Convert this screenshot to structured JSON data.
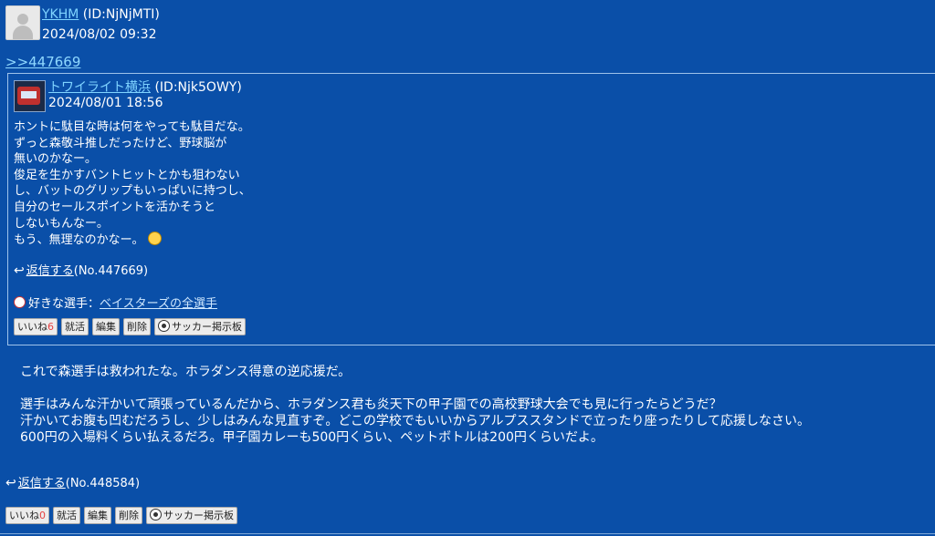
{
  "post": {
    "username": "YKHM",
    "user_id": "(ID:NjNjMTI)",
    "date": "2024/08/02 09:32",
    "reply_anchor": ">>447669",
    "quote": {
      "username": "トワイライト横浜",
      "user_id": "(ID:Njk5OWY)",
      "date": "2024/08/01 18:56",
      "body_lines": [
        "ホントに駄目な時は何をやっても駄目だな。",
        "ずっと森敬斗推しだったけど、野球脳が",
        "無いのかなー。",
        "俊足を生かすバントヒットとかも狙わない",
        "し、バットのグリップもいっぱいに持つし、",
        "自分のセールスポイントを活かそうと",
        "しないもんなー。",
        "もう、無理なのかなー。"
      ],
      "reply_label": "返信する",
      "reply_no": "(No.447669)",
      "fav_label": "好きな選手：",
      "fav_value": "ベイスターズの全選手",
      "buttons": {
        "like": "いいね",
        "like_count": "6",
        "job": "就活",
        "edit": "編集",
        "delete": "削除",
        "board": "サッカー掲示板"
      }
    },
    "body_lines": [
      "これで森選手は救われたな。ホラダンス得意の逆応援だ。",
      "",
      "選手はみんな汗かいて頑張っているんだから、ホラダンス君も炎天下の甲子園での高校野球大会でも見に行ったらどうだ？",
      "汗かいてお腹も凹むだろうし、少しはみんな見直すぞ。どこの学校でもいいからアルプススタンドで立ったり座ったりして応援しなさい。",
      "600円の入場料くらい払えるだろ。甲子園カレーも500円くらい、ペットボトルは200円くらいだよ。"
    ],
    "reply_label": "返信する",
    "reply_no": "(No.448584)",
    "buttons": {
      "like": "いいね",
      "like_count": "0",
      "job": "就活",
      "edit": "編集",
      "delete": "削除",
      "board": "サッカー掲示板"
    }
  }
}
